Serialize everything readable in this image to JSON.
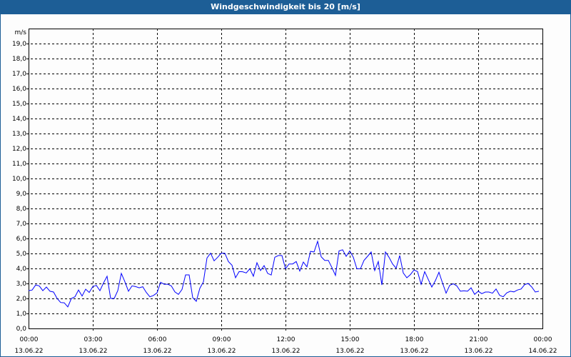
{
  "window": {
    "title": "Windgeschwindigkeit bis 20 [m/s]"
  },
  "chart_data": {
    "type": "line",
    "title": "Windgeschwindigkeit bis 20 [m/s]",
    "ylabel": "m/s",
    "ylim": [
      0,
      20
    ],
    "yticks": [
      "0,0",
      "1,0",
      "2,0",
      "3,0",
      "4,0",
      "5,0",
      "6,0",
      "7,0",
      "8,0",
      "9,0",
      "10,0",
      "11,0",
      "12,0",
      "13,0",
      "14,0",
      "15,0",
      "16,0",
      "17,0",
      "18,0",
      "19,0"
    ],
    "xlim_hours": [
      0,
      24
    ],
    "xticks": [
      {
        "time": "00:00",
        "date": "13.06.22",
        "hour": 0
      },
      {
        "time": "03:00",
        "date": "13.06.22",
        "hour": 3
      },
      {
        "time": "06:00",
        "date": "13.06.22",
        "hour": 6
      },
      {
        "time": "09:00",
        "date": "13.06.22",
        "hour": 9
      },
      {
        "time": "12:00",
        "date": "13.06.22",
        "hour": 12
      },
      {
        "time": "15:00",
        "date": "13.06.22",
        "hour": 15
      },
      {
        "time": "18:00",
        "date": "13.06.22",
        "hour": 18
      },
      {
        "time": "21:00",
        "date": "13.06.22",
        "hour": 21
      },
      {
        "time": "00:00",
        "date": "14.06.22",
        "hour": 24
      }
    ],
    "grid": true,
    "series_color": "#0000ff",
    "interval_minutes": 10,
    "series": [
      {
        "name": "Windgeschwindigkeit",
        "values": [
          2.52,
          2.56,
          2.9,
          2.84,
          2.52,
          2.76,
          2.48,
          2.43,
          2.0,
          1.73,
          1.71,
          1.44,
          2.0,
          2.11,
          2.56,
          2.16,
          2.62,
          2.4,
          2.79,
          2.87,
          2.52,
          3.03,
          3.48,
          2.0,
          2.0,
          2.52,
          3.67,
          3.11,
          2.48,
          2.84,
          2.79,
          2.71,
          2.78,
          2.4,
          2.11,
          2.2,
          2.37,
          3.08,
          2.95,
          2.95,
          2.84,
          2.44,
          2.27,
          2.6,
          3.57,
          3.57,
          2.05,
          1.81,
          2.68,
          3.11,
          4.7,
          5.02,
          4.51,
          4.75,
          5.02,
          5.02,
          4.46,
          4.22,
          3.38,
          3.79,
          3.78,
          3.7,
          3.98,
          3.48,
          4.38,
          3.86,
          4.19,
          3.67,
          3.56,
          4.75,
          4.86,
          4.86,
          3.98,
          4.3,
          4.3,
          4.46,
          3.83,
          4.43,
          4.11,
          5.14,
          5.1,
          5.81,
          4.78,
          4.54,
          4.54,
          4.06,
          3.54,
          5.17,
          5.25,
          4.81,
          5.17,
          4.75,
          3.98,
          3.98,
          4.54,
          4.81,
          5.1,
          3.86,
          4.46,
          2.9,
          5.1,
          4.75,
          4.3,
          4.02,
          4.86,
          3.7,
          3.38,
          3.59,
          3.9,
          3.79,
          2.95,
          3.79,
          3.27,
          2.76,
          3.19,
          3.75,
          3.03,
          2.35,
          2.87,
          2.98,
          2.84,
          2.48,
          2.51,
          2.48,
          2.71,
          2.27,
          2.48,
          2.32,
          2.43,
          2.43,
          2.35,
          2.63,
          2.21,
          2.11,
          2.37,
          2.48,
          2.44,
          2.56,
          2.63,
          2.92,
          3.0,
          2.76,
          2.43,
          2.48
        ]
      }
    ]
  }
}
